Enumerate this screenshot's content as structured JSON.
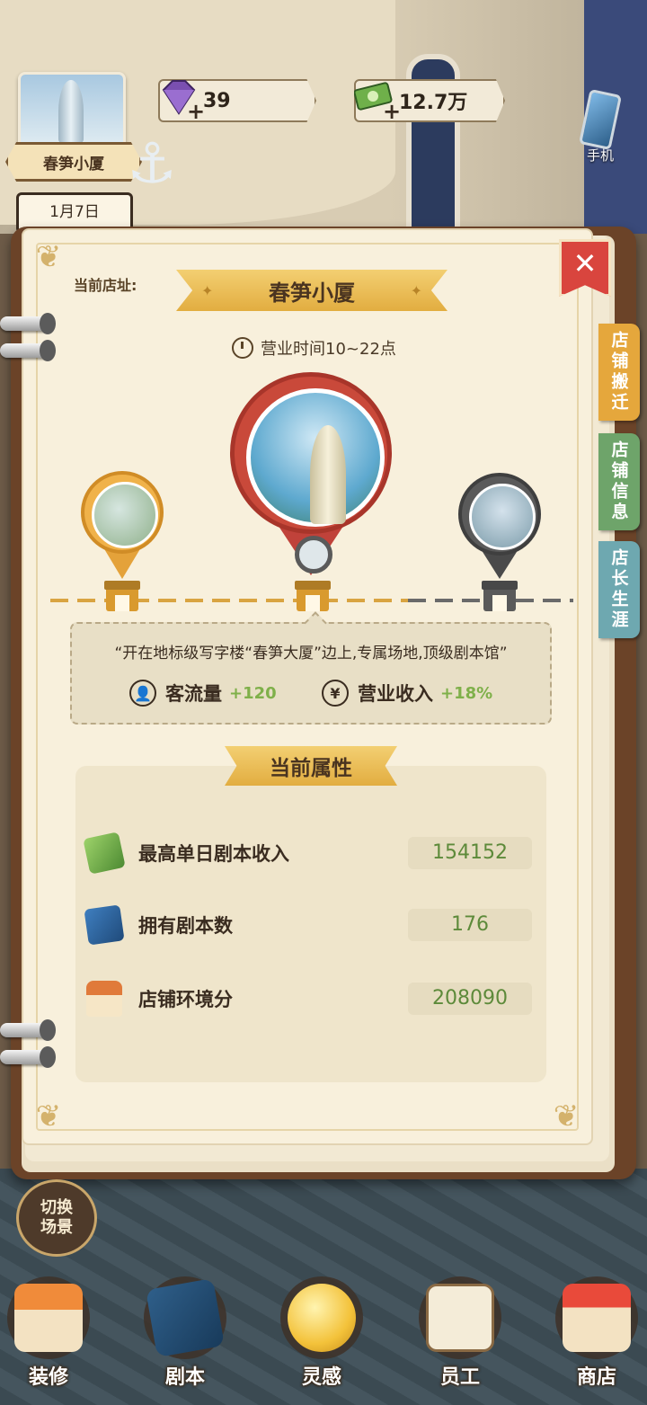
{
  "hud": {
    "shop_name": "春笋小厦",
    "gems": "39",
    "cash": "12.7万",
    "phone_label": "手机",
    "date": "1月7日"
  },
  "panel": {
    "address_label": "当前店址:",
    "shop_title": "春笋小厦",
    "hours": "营业时间10~22点",
    "description": "“开在地标级写字楼“春笋大厦”边上,专属场地,顶级剧本馆”",
    "bonuses": {
      "flow_label": "客流量",
      "flow_value": "+120",
      "income_label": "营业收入",
      "income_value": "+18%"
    },
    "attributes_title": "当前属性",
    "attributes": [
      {
        "label": "最高单日剧本收入",
        "value": "154152"
      },
      {
        "label": "拥有剧本数",
        "value": "176"
      },
      {
        "label": "店铺环境分",
        "value": "208090"
      }
    ],
    "close_symbol": "✕"
  },
  "side_tabs": {
    "move": "店铺搬迁",
    "info": "店铺信息",
    "career": "店长生涯"
  },
  "bottom": {
    "switch_scene": [
      "切换",
      "场景"
    ],
    "nav": [
      "装修",
      "剧本",
      "灵感",
      "员工",
      "商店"
    ]
  },
  "colors": {
    "accent_gold": "#e2ad40",
    "close_red": "#d9453e",
    "value_green": "#5d8a3a",
    "bonus_green": "#7fb04a"
  },
  "icons": [
    "gem-icon",
    "cash-icon",
    "phone-icon",
    "anchor-icon",
    "clock-icon",
    "visitors-icon",
    "yen-icon",
    "money-icon",
    "script-book-icon",
    "house-icon"
  ]
}
